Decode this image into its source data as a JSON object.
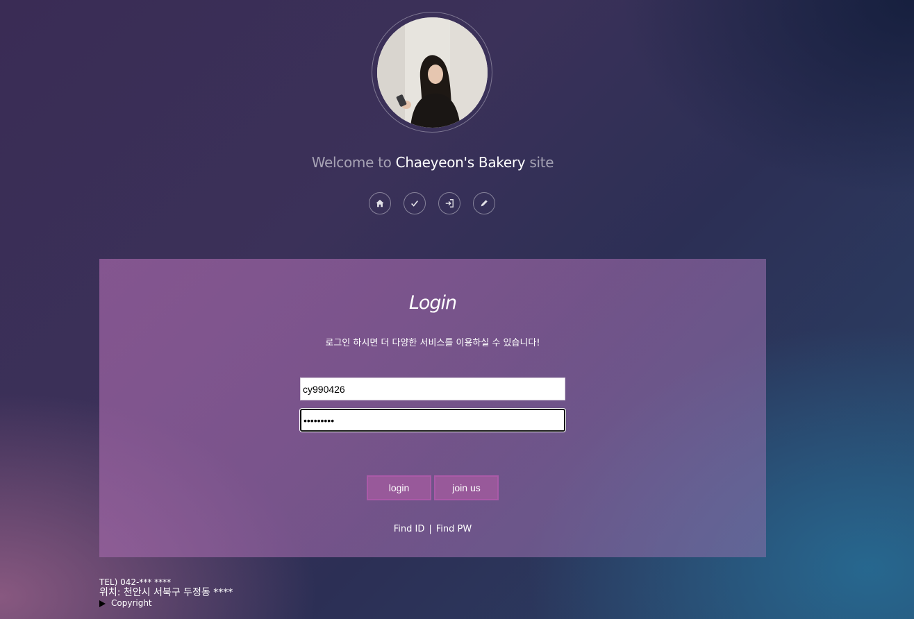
{
  "header": {
    "welcome_prefix": "Welcome to ",
    "brand": "Chaeyeon's Bakery",
    "welcome_suffix": " site",
    "nav": [
      {
        "icon": "home-icon"
      },
      {
        "icon": "check-icon"
      },
      {
        "icon": "sign-in-icon"
      },
      {
        "icon": "pencil-icon"
      }
    ]
  },
  "login": {
    "title": "Login",
    "description": "로그인 하시면 더 다양한 서비스를 이용하실 수 있습니다!",
    "id_value": "cy990426",
    "password_mask": "•••••••••",
    "login_label": "login",
    "join_label": "join us",
    "find_id": "Find ID",
    "separator": "|",
    "find_pw": "Find PW"
  },
  "footer": {
    "tel": "TEL) 042-***  ****",
    "address": "위치: 천안시 서북구 두정동 ****",
    "copyright": "Copyright"
  },
  "colors": {
    "panel": "#9a64a2",
    "button": "#98599a"
  }
}
